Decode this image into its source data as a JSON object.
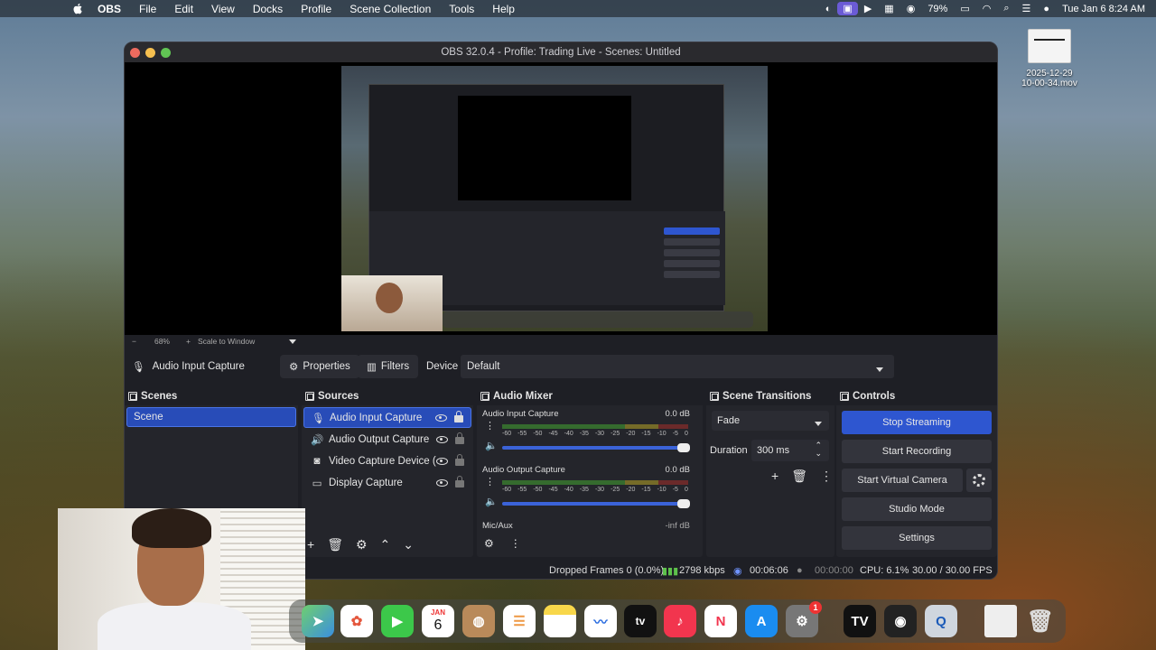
{
  "menubar": {
    "app": "OBS",
    "items": [
      "File",
      "Edit",
      "View",
      "Docks",
      "Profile",
      "Scene Collection",
      "Tools",
      "Help"
    ],
    "battery": "79%",
    "datetime": "Tue Jan 6  8:24 AM"
  },
  "desktop_file": {
    "name_line1": "2025-12-29",
    "name_line2": "10-00-34.mov"
  },
  "window": {
    "title": "OBS 32.0.4 - Profile: Trading Live - Scenes: Untitled",
    "zoom": "68%",
    "scale_mode": "Scale to Window"
  },
  "source_toolbar": {
    "selected_source": "Audio Input Capture",
    "properties": "Properties",
    "filters": "Filters",
    "device_label": "Device",
    "device_value": "Default"
  },
  "scenes": {
    "title": "Scenes",
    "items": [
      "Scene"
    ]
  },
  "sources": {
    "title": "Sources",
    "items": [
      {
        "label": "Audio Input Capture",
        "icon": "mic-icon"
      },
      {
        "label": "Audio Output Capture",
        "icon": "speaker-icon"
      },
      {
        "label": "Video Capture Device (Leg:",
        "icon": "camera-icon"
      },
      {
        "label": "Display Capture",
        "icon": "monitor-icon"
      }
    ]
  },
  "mixer": {
    "title": "Audio Mixer",
    "channels": [
      {
        "name": "Audio Input Capture",
        "db": "0.0 dB"
      },
      {
        "name": "Audio Output Capture",
        "db": "0.0 dB"
      },
      {
        "name": "Mic/Aux",
        "db": "-inf dB"
      }
    ],
    "ticks": [
      "-60",
      "-55",
      "-50",
      "-45",
      "-40",
      "-35",
      "-30",
      "-25",
      "-20",
      "-15",
      "-10",
      "-5",
      "0"
    ]
  },
  "transitions": {
    "title": "Scene Transitions",
    "type": "Fade",
    "duration_label": "Duration",
    "duration_value": "300 ms"
  },
  "controls": {
    "title": "Controls",
    "stop_streaming": "Stop Streaming",
    "start_recording": "Start Recording",
    "start_virtual_camera": "Start Virtual Camera",
    "studio_mode": "Studio Mode",
    "settings": "Settings"
  },
  "status": {
    "dropped": "Dropped Frames 0 (0.0%)",
    "bitrate": "2798 kbps",
    "stream_time": "00:06:06",
    "rec_time": "00:00:00",
    "cpu": "CPU: 6.1%",
    "fps": "30.00 / 30.00 FPS"
  },
  "dock_calendar": {
    "month": "JAN",
    "day": "6"
  },
  "dock_badge": "1",
  "colors": {
    "accent": "#2e56d0",
    "selection": "#284cb8",
    "panel": "#24252b"
  }
}
